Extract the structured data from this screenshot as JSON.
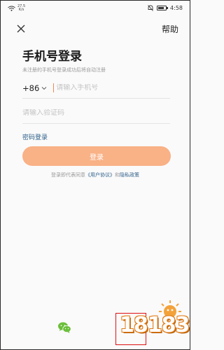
{
  "status_bar": {
    "net_speed_value": "27.5",
    "net_speed_unit": "K/s",
    "time": "4:58"
  },
  "header": {
    "help_label": "帮助"
  },
  "login": {
    "title": "手机号登录",
    "subtitle": "未注册的手机号登录成功后将自动注册",
    "country_code": "+86",
    "phone_placeholder": "请输入手机号",
    "code_placeholder": "请输入验证码",
    "password_login_label": "密码登录",
    "login_button_label": "登录"
  },
  "agreement": {
    "prefix": "登录即代表同意",
    "user_agreement": "《用户协议》",
    "conjunction": "和",
    "privacy_policy": "隐私政策"
  },
  "watermark": {
    "text": "18183"
  },
  "colors": {
    "accent": "#f9b186",
    "caret": "#f08a4b",
    "link": "#2d5f8a",
    "wechat": "#6bbf3a"
  }
}
